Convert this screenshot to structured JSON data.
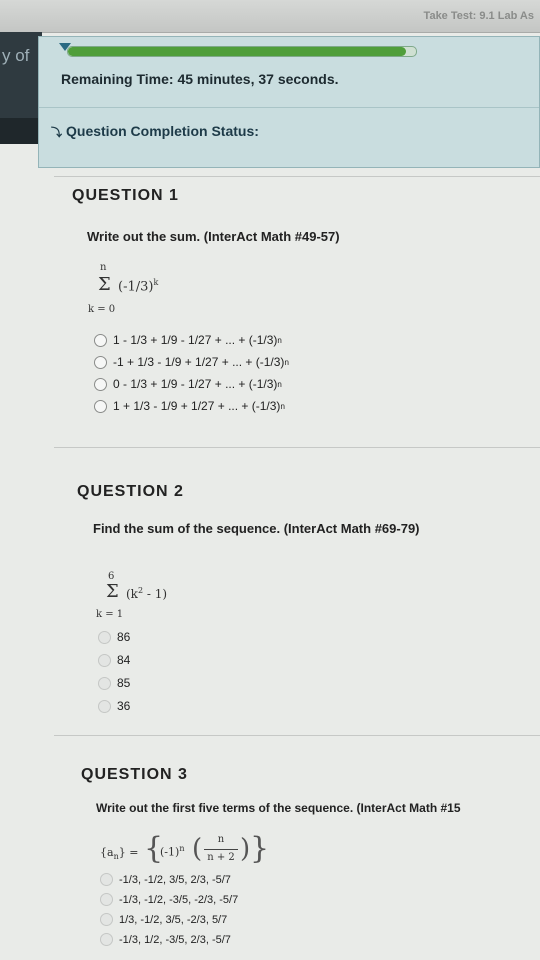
{
  "window": {
    "title": "Take Test: 9.1 Lab As"
  },
  "left_strip": {
    "text": "y of"
  },
  "timer": {
    "remaining_label": "Remaining Time:",
    "remaining_value": "45 minutes, 37 seconds.",
    "progress_fraction": 0.97,
    "completion_label": "Question Completion Status:"
  },
  "questions": [
    {
      "header": "QUESTION 1",
      "prompt": "Write out the sum. (InterAct Math #49-57)",
      "expr_upper": "n",
      "expr_body": "(-1/3)",
      "expr_body_sup": "k",
      "expr_lower": "k = 0",
      "options": [
        {
          "text": "1 - 1/3 + 1/9 - 1/27 + ... + (-1/3)",
          "sup": "n"
        },
        {
          "text": "-1 + 1/3 - 1/9 + 1/27 + ... + (-1/3)",
          "sup": "n"
        },
        {
          "text": "0 - 1/3 + 1/9 - 1/27 + ... + (-1/3)",
          "sup": "n"
        },
        {
          "text": "1 + 1/3 - 1/9 + 1/27 + ... + (-1/3)",
          "sup": "n"
        }
      ]
    },
    {
      "header": "QUESTION 2",
      "prompt": "Find the sum of the sequence. (InterAct Math #69-79)",
      "expr_upper": "6",
      "expr_body": "(k",
      "expr_body_sup": "2",
      "expr_body_tail": " - 1)",
      "expr_lower": "k = 1",
      "options": [
        {
          "text": "86"
        },
        {
          "text": "84"
        },
        {
          "text": "85"
        },
        {
          "text": "36"
        }
      ]
    },
    {
      "header": "QUESTION 3",
      "prompt": "Write out the first five terms of the sequence. (InterAct Math #15",
      "expr_lhs": "{a",
      "expr_lhs_sub": "n",
      "expr_lhs_tail": "} =",
      "expr_factor": "(-1)",
      "expr_factor_sup": "n",
      "expr_num": "n",
      "expr_den": "n + 2",
      "options": [
        {
          "text": "-1/3, -1/2, 3/5, 2/3, -5/7"
        },
        {
          "text": "-1/3, -1/2, -3/5, -2/3, -5/7"
        },
        {
          "text": "1/3, -1/2, 3/5, -2/3, 5/7"
        },
        {
          "text": "-1/3, 1/2, -3/5, 2/3, -5/7"
        }
      ]
    }
  ]
}
